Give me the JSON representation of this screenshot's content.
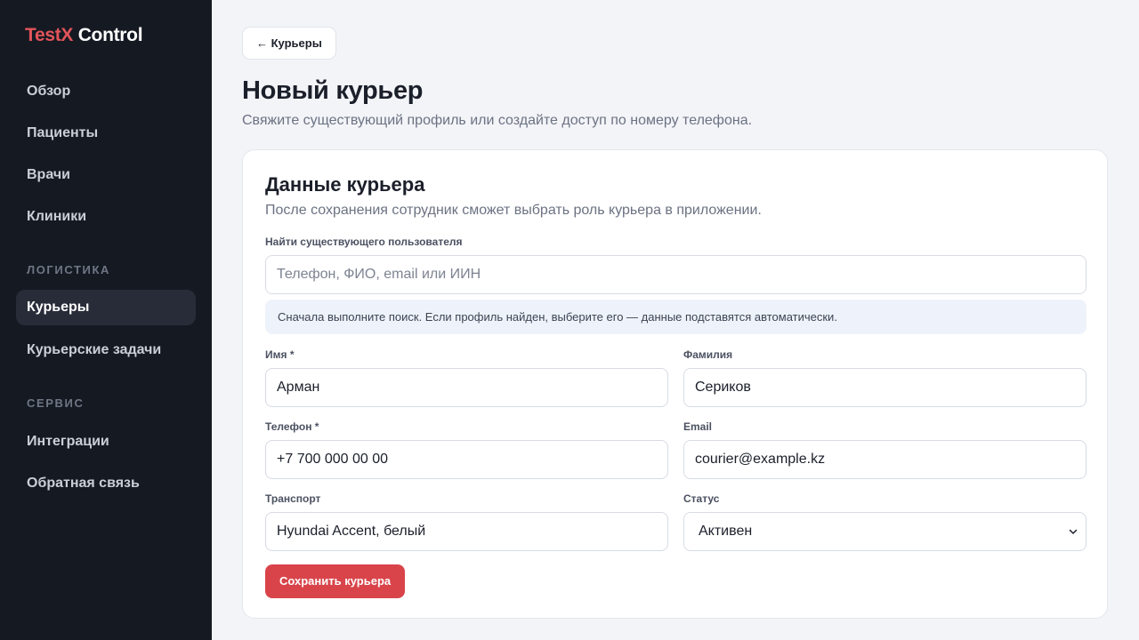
{
  "app": {
    "brand_part1": "TestX",
    "brand_part2": "Control"
  },
  "sidebar": {
    "items": [
      {
        "label": "Обзор"
      },
      {
        "label": "Пациенты"
      },
      {
        "label": "Врачи"
      },
      {
        "label": "Клиники"
      }
    ],
    "sections": [
      {
        "title": "ЛОГИСТИКА",
        "items": [
          {
            "label": "Курьеры",
            "active": true
          },
          {
            "label": "Курьерские задачи"
          }
        ]
      },
      {
        "title": "СЕРВИС",
        "items": [
          {
            "label": "Интеграции"
          },
          {
            "label": "Обратная связь"
          }
        ]
      }
    ]
  },
  "header": {
    "back_label": "← Курьеры",
    "title": "Новый курьер",
    "subtitle": "Свяжите существующий профиль или создайте доступ по номеру телефона."
  },
  "form": {
    "title": "Данные курьера",
    "subtitle": "После сохранения сотрудник сможет выбрать роль курьера в приложении.",
    "search": {
      "label": "Найти существующего пользователя",
      "placeholder": "Телефон, ФИО, email или ИИН",
      "value": ""
    },
    "hint": "Сначала выполните поиск. Если профиль найден, выберите его — данные подставятся автоматически.",
    "first_name": {
      "label": "Имя *",
      "value": "Арман"
    },
    "last_name": {
      "label": "Фамилия",
      "value": "Сериков"
    },
    "phone": {
      "label": "Телефон *",
      "value": "+7 700 000 00 00"
    },
    "email": {
      "label": "Email",
      "value": "courier@example.kz"
    },
    "transport": {
      "label": "Транспорт",
      "value": "Hyundai Accent, белый"
    },
    "status": {
      "label": "Статус",
      "value": "Активен"
    },
    "save_label": "Сохранить курьера"
  },
  "colors": {
    "accent": "#d8444a",
    "sidebar_bg": "#151922",
    "page_bg": "#f3f4f8"
  }
}
